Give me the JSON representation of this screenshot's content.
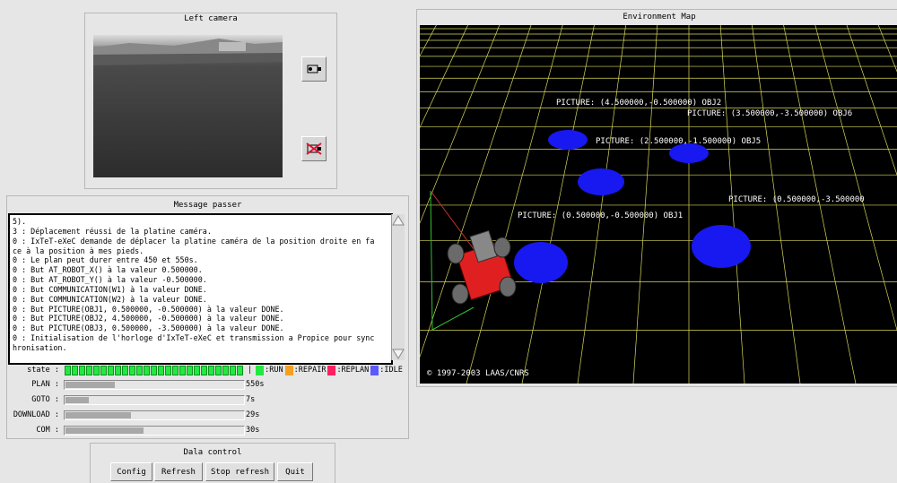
{
  "camera": {
    "title": "Left camera"
  },
  "message": {
    "title": "Message passer",
    "lines": [
      "5).",
      "3 : Déplacement réussi de la platine caméra.",
      "0 : IxTeT-eXeC demande de déplacer la platine caméra de la position droite en fa",
      "ce à la position à mes pieds.",
      "0 : Le plan peut durer entre 450 et 550s.",
      "0 : But AT_ROBOT_X() à la valeur 0.500000.",
      "0 : But AT_ROBOT_Y() à la valeur -0.500000.",
      "0 : But COMMUNICATION(W1) à la valeur DONE.",
      "0 : But COMMUNICATION(W2) à la valeur DONE.",
      "0 : But PICTURE(OBJ1, 0.500000, -0.500000) à la valeur DONE.",
      "0 : But PICTURE(OBJ2, 4.500000, -0.500000) à la valeur DONE.",
      "0 : But PICTURE(OBJ3, 0.500000, -3.500000) à la valeur DONE.",
      "0 : Initialisation de l'horloge d'IxTeT-eXeC et transmission a Propice pour sync",
      "hronisation."
    ]
  },
  "status": {
    "state_label": "state :",
    "separator": "|",
    "legend": [
      {
        "label": ":RUN",
        "color": "#22e840"
      },
      {
        "label": ":REPAIR",
        "color": "#f5a020"
      },
      {
        "label": ":REPLAN",
        "color": "#ff2060"
      },
      {
        "label": ":IDLE",
        "color": "#5a5aff"
      }
    ],
    "bars": [
      {
        "label": "PLAN :",
        "value": "550s",
        "fill": 0.28
      },
      {
        "label": "GOTO :",
        "value": "7s",
        "fill": 0.13
      },
      {
        "label": "DOWNLOAD :",
        "value": "29s",
        "fill": 0.37
      },
      {
        "label": "COM :",
        "value": "30s",
        "fill": 0.44
      }
    ]
  },
  "control": {
    "title": "Dala control",
    "buttons": {
      "config": "Config",
      "refresh": "Refresh",
      "stop": "Stop refresh",
      "quit": "Quit"
    }
  },
  "map": {
    "title": "Environment Map",
    "labels": [
      "PICTURE: (4.500000,-0.500000) OBJ2",
      "PICTURE: (3.500000,-3.500000) OBJ6",
      "PICTURE: (2.500000,-1.500000) OBJ5",
      "PICTURE: (0.500000,-3.500000",
      "PICTURE: (0.500000,-0.500000) OBJ1"
    ],
    "copyright": "© 1997-2003 LAAS/CNRS"
  }
}
